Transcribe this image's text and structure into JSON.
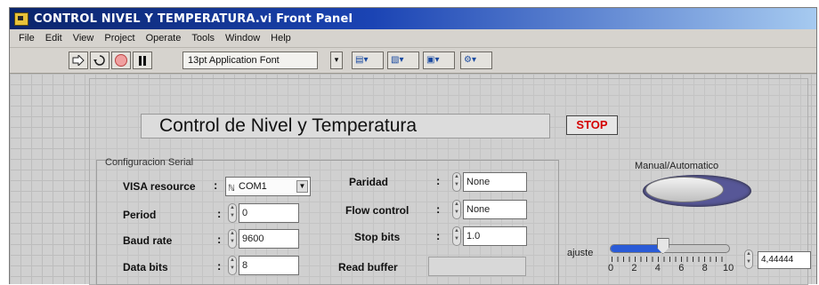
{
  "window": {
    "title": "CONTROL NIVEL Y TEMPERATURA.vi Front Panel"
  },
  "menu": [
    "File",
    "Edit",
    "View",
    "Project",
    "Operate",
    "Tools",
    "Window",
    "Help"
  ],
  "toolbar": {
    "run_icon": "run-arrow-icon",
    "run_continuous_icon": "run-continuously-icon",
    "abort_icon": "abort-icon",
    "pause_icon": "pause-icon",
    "font": "13pt Application Font"
  },
  "panel": {
    "title": "Control de Nivel y Temperatura",
    "stop_label": "STOP",
    "serial_config_title": "Configuracion Serial",
    "visa": {
      "label": "VISA resource",
      "value": "COM1"
    },
    "left_fields": [
      {
        "label": "Period",
        "value": "0"
      },
      {
        "label": "Baud rate",
        "value": "9600"
      },
      {
        "label": "Data bits",
        "value": "8"
      }
    ],
    "right_fields": [
      {
        "label": "Paridad",
        "value": "None"
      },
      {
        "label": "Flow control",
        "value": "None"
      },
      {
        "label": "Stop bits",
        "value": "1.0"
      }
    ],
    "read_buffer_label": "Read buffer",
    "manual_auto_label": "Manual/Automatico",
    "ajuste": {
      "label": "ajuste",
      "value": "4,44444",
      "scale_min": 0,
      "scale_max": 10,
      "level": 4.44444,
      "ticks": [
        "0",
        "2",
        "4",
        "6",
        "8",
        "10"
      ]
    }
  },
  "colors": {
    "stop_text": "#d40000",
    "slider_fill": "#2a5bd7",
    "toggle_ring": "#575797"
  }
}
